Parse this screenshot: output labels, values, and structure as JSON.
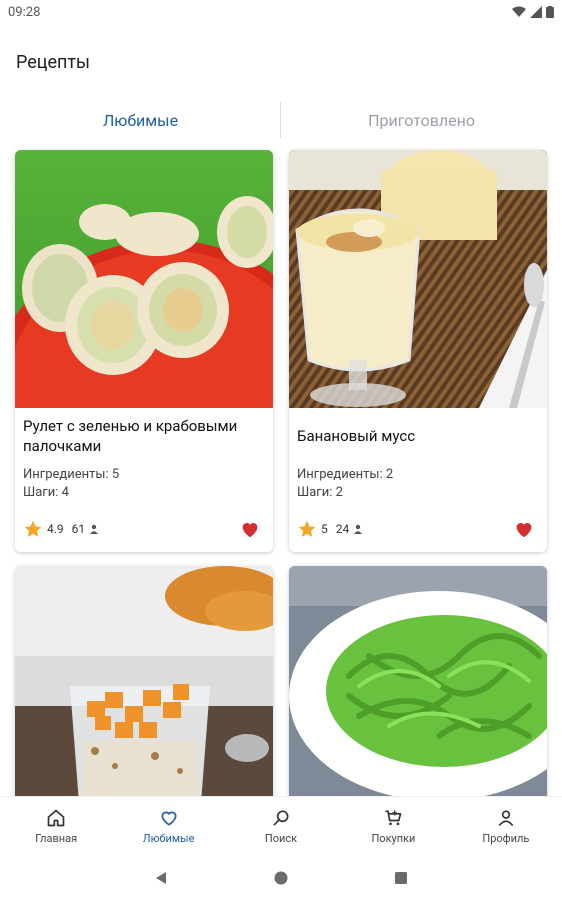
{
  "status_bar": {
    "time": "09:28"
  },
  "header": {
    "title": "Рецепты"
  },
  "tabs": [
    {
      "label": "Любимые",
      "active": true
    },
    {
      "label": "Приготовлено",
      "active": false
    }
  ],
  "recipes": [
    {
      "title": "Рулет с зеленью и крабовыми палочками",
      "ingredients": "Ингредиенты: 5",
      "steps": "Шаги: 4",
      "rating": "4.9",
      "reviews": "61",
      "favorite": true
    },
    {
      "title": "Банановый мусс",
      "ingredients": "Ингредиенты: 2",
      "steps": "Шаги: 2",
      "rating": "5",
      "reviews": "24",
      "favorite": true
    },
    {
      "title": "",
      "favorite": true
    },
    {
      "title": "",
      "favorite": true
    }
  ],
  "bottom_nav": [
    {
      "label": "Главная",
      "icon": "home-icon",
      "active": false
    },
    {
      "label": "Любимые",
      "icon": "heart-icon",
      "active": true
    },
    {
      "label": "Поиск",
      "icon": "search-icon",
      "active": false
    },
    {
      "label": "Покупки",
      "icon": "cart-icon",
      "active": false
    },
    {
      "label": "Профиль",
      "icon": "profile-icon",
      "active": false
    }
  ],
  "colors": {
    "accent": "#1f5fa8",
    "inactive_tab": "#9aa0a6",
    "star": "#f5a623",
    "heart": "#d32f2f"
  }
}
